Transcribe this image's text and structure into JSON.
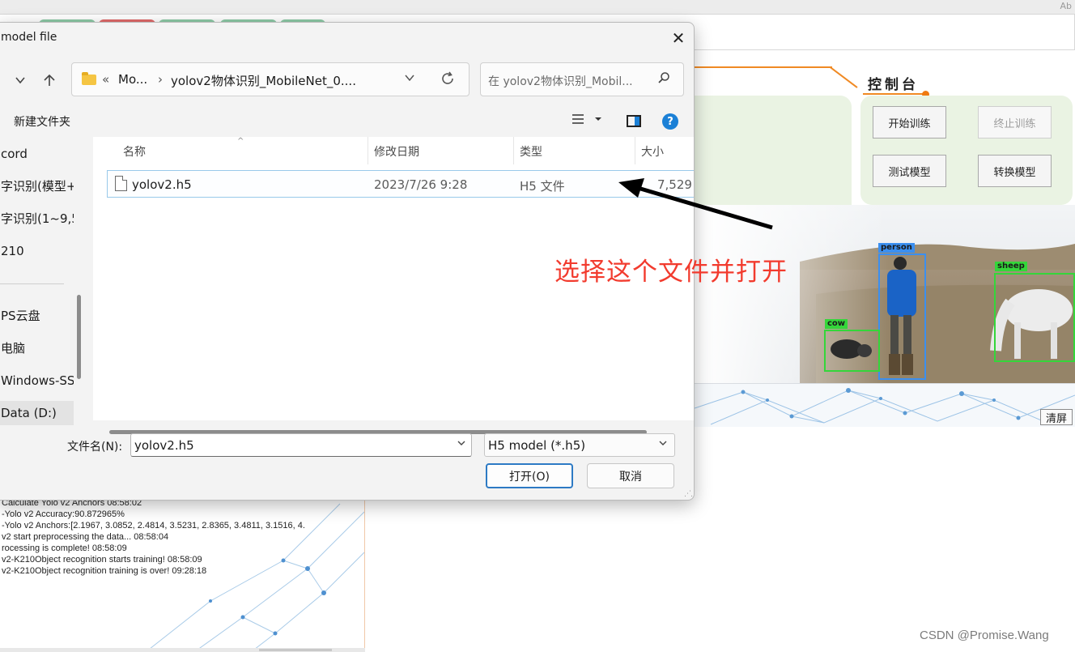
{
  "app": {
    "corner_text": "Ab",
    "control_panel_title": "控制台",
    "buttons": {
      "start_training": "开始训练",
      "stop_training": "终止训练",
      "test_model": "测试模型",
      "convert_model": "转换模型",
      "clear": "清屏"
    },
    "detections": [
      {
        "label": "person",
        "color": "#3b8ff0"
      },
      {
        "label": "sheep",
        "color": "#34d63a"
      },
      {
        "label": "cow",
        "color": "#34d63a"
      }
    ],
    "log_lines": [
      "Calculate Yolo v2 Anchors   08:58:02",
      "-Yolo v2 Accuracy:90.872965%",
      "-Yolo v2 Anchors:[2.1967, 3.0852, 2.4814, 3.5231, 2.8365, 3.4811, 3.1516, 4.",
      " v2 start preprocessing the data...  08:58:04",
      "rocessing is complete!  08:58:09",
      "v2-K210Object recognition starts training!  08:58:09",
      "v2-K210Object recognition training is over!  09:28:18"
    ]
  },
  "annotation": "选择这个文件并打开",
  "watermark": "CSDN @Promise.Wang",
  "dialog": {
    "title": "model file",
    "close_glyph": "✕",
    "address": {
      "prefix": "«",
      "crumbs": [
        "Mo...",
        "yolov2物体识别_MobileNet_0...."
      ],
      "separator": "›"
    },
    "search_placeholder": "在 yolov2物体识别_Mobil...",
    "new_folder": "新建文件夹",
    "sidebar": [
      "cord",
      "字识别(模型+",
      "字识别(1~9,5",
      "210",
      "PS云盘",
      "电脑",
      "Windows-SSD",
      "Data (D:)"
    ],
    "columns": [
      "名称",
      "修改日期",
      "类型",
      "大小"
    ],
    "files": [
      {
        "name": "yolov2.h5",
        "modified": "2023/7/26 9:28",
        "type": "H5 文件",
        "size": "7,529"
      }
    ],
    "filename_label": "文件名(N):",
    "filename_value": "yolov2.h5",
    "filetype_value": "H5 model (*.h5)",
    "open_button": "打开(O)",
    "cancel_button": "取消"
  },
  "colors": {
    "accent_orange": "#f08a24",
    "panel_green": "#eaf3e3",
    "annotation_red": "#f23b2e",
    "dialog_primary": "#2d7ac4"
  }
}
